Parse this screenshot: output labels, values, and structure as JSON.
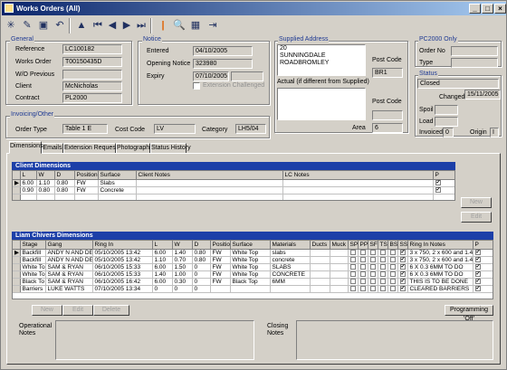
{
  "window": {
    "title": "Works Orders (All)"
  },
  "toolbar": {
    "icons": [
      "new-icon",
      "edit-icon",
      "save-icon",
      "undo-icon",
      "sep",
      "alert-icon",
      "first-icon",
      "prev-icon",
      "next-icon",
      "last-icon",
      "sep",
      "warning-bar-icon",
      "search-icon",
      "calculator-icon",
      "exit-icon"
    ]
  },
  "general": {
    "title": "General",
    "reference_label": "Reference",
    "reference": "LC100182",
    "works_order_label": "Works Order",
    "works_order": "T00150435D",
    "wo_previous_label": "W/O Previous",
    "wo_previous": "",
    "client_label": "Client",
    "client": "McNicholas",
    "contract_label": "Contract",
    "contract": "PL2000"
  },
  "notice": {
    "title": "Notice",
    "entered_label": "Entered",
    "entered": "04/10/2005",
    "opening_label": "Opening Notice",
    "opening": "323980",
    "expiry_label": "Expiry",
    "expiry": "07/10/2005",
    "expiry_extra": "",
    "ext_challenged": "Extension Challenged"
  },
  "supplied": {
    "title": "Supplied Address",
    "address_line1": "20",
    "address_line2": "SUNNINGDALE ROADBROMLEY",
    "postcode_label": "Post Code",
    "postcode": "BR1",
    "actual_label": "Actual (if different from Supplied)",
    "actual_postcode_label": "Post Code",
    "actual_postcode": "",
    "area_label": "Area",
    "area": "6"
  },
  "pc2000": {
    "title": "PC2000 Only",
    "order_no_label": "Order No",
    "order_no": "",
    "type_label": "Type",
    "type": ""
  },
  "status": {
    "title": "Status",
    "value": "Closed",
    "changed_label": "Changed",
    "changed": "15/11/2005",
    "spoil_label": "Spoil",
    "spoil": "",
    "load_label": "Load",
    "load": "",
    "invoiced_label": "Invoiced",
    "invoiced": "0",
    "origin_label": "Origin",
    "origin": "I"
  },
  "invoicing": {
    "title": "Invoicing/Other",
    "order_type_label": "Order Type",
    "order_type": "Table 1 E",
    "cost_code_label": "Cost Code",
    "cost_code": "LV",
    "category_label": "Category",
    "category": "LH5/04"
  },
  "tabs": [
    "Dimensions",
    "Emails",
    "Extension Requests",
    "Photographs",
    "Status History"
  ],
  "client_dimensions": {
    "title": "Client Dimensions",
    "columns": [
      "L",
      "W",
      "D",
      "Position",
      "Surface",
      "Client Notes",
      "LC Notes",
      "P"
    ],
    "rows": [
      {
        "l": "6.00",
        "w": "1.10",
        "d": "0.80",
        "position": "FW",
        "surface": "Slabs",
        "client_notes": "",
        "lc_notes": "",
        "p": true
      },
      {
        "l": "0.90",
        "w": "0.80",
        "d": "0.80",
        "position": "FW",
        "surface": "Concrete",
        "client_notes": "",
        "lc_notes": "",
        "p": true
      }
    ],
    "new_label": "New",
    "edit_label": "Edit"
  },
  "liam_dimensions": {
    "title": "Liam Chivers Dimensions",
    "columns": [
      "Stage",
      "Gang",
      "Ring In",
      "L",
      "W",
      "D",
      "Position",
      "Surface",
      "Materials",
      "Ducts",
      "Muck",
      "SP",
      "PP",
      "SF",
      "TS",
      "BS",
      "SS",
      "Ring In Notes",
      "P"
    ],
    "rows": [
      {
        "stage": "Backfill",
        "gang": "ANDY N AND DE",
        "ring_in": "05/10/2005 13:42",
        "l": "6.00",
        "w": "1.40",
        "d": "0.80",
        "position": "FW",
        "surface": "White Top",
        "materials": "slabs",
        "ss": true,
        "notes": "3 x 750, 2 x 600 and 1.4",
        "p": true
      },
      {
        "stage": "Backfill",
        "gang": "ANDY N AND DE",
        "ring_in": "05/10/2005 13:42",
        "l": "1.10",
        "w": "0.70",
        "d": "0.80",
        "position": "FW",
        "surface": "White Top",
        "materials": "concrete",
        "ss": true,
        "notes": "3 x 750, 2 x 600 and 1.4",
        "p": true
      },
      {
        "stage": "White To",
        "gang": "SAM & RYAN",
        "ring_in": "06/10/2005 15:33",
        "l": "6.00",
        "w": "1.50",
        "d": "0",
        "position": "FW",
        "surface": "White Top",
        "materials": "SLABS",
        "ss": true,
        "notes": "6 X 0.3 6MM TO DO",
        "p": true
      },
      {
        "stage": "White To",
        "gang": "SAM & RYAN",
        "ring_in": "06/10/2005 15:33",
        "l": "1.40",
        "w": "1.00",
        "d": "0",
        "position": "FW",
        "surface": "White Top",
        "materials": "CONCRETE",
        "ss": true,
        "notes": "6 X 0.3 6MM TO DO",
        "p": true
      },
      {
        "stage": "Black To",
        "gang": "SAM & RYAN",
        "ring_in": "06/10/2005 16:42",
        "l": "6.00",
        "w": "0.30",
        "d": "0",
        "position": "FW",
        "surface": "Black Top",
        "materials": "6MM",
        "ss": true,
        "notes": "THIS IS TO BE DONE",
        "p": true
      },
      {
        "stage": "Barriers",
        "gang": "LUKE WATTS",
        "ring_in": "07/10/2005 13:34",
        "l": "0",
        "w": "0",
        "d": "0",
        "position": "",
        "surface": "",
        "materials": "",
        "ss": true,
        "notes": "CLEARED BARRIERS",
        "p": true
      }
    ],
    "new_label": "New",
    "edit_label": "Edit",
    "delete_label": "Delete",
    "programming_label": "Programming 'Off'"
  },
  "notes": {
    "operational_label": "Operational Notes",
    "closing_label": "Closing Notes"
  }
}
